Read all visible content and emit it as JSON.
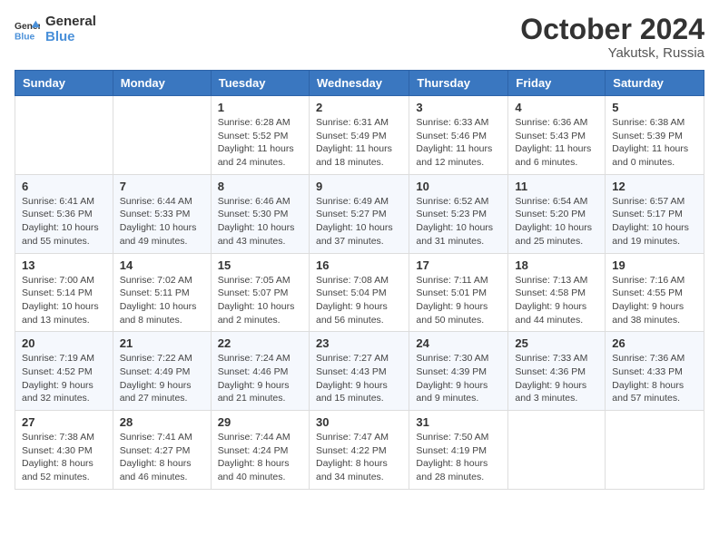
{
  "logo": {
    "line1": "General",
    "line2": "Blue"
  },
  "title": "October 2024",
  "subtitle": "Yakutsk, Russia",
  "days_header": [
    "Sunday",
    "Monday",
    "Tuesday",
    "Wednesday",
    "Thursday",
    "Friday",
    "Saturday"
  ],
  "weeks": [
    [
      {
        "day": "",
        "content": ""
      },
      {
        "day": "",
        "content": ""
      },
      {
        "day": "1",
        "content": "Sunrise: 6:28 AM\nSunset: 5:52 PM\nDaylight: 11 hours and 24 minutes."
      },
      {
        "day": "2",
        "content": "Sunrise: 6:31 AM\nSunset: 5:49 PM\nDaylight: 11 hours and 18 minutes."
      },
      {
        "day": "3",
        "content": "Sunrise: 6:33 AM\nSunset: 5:46 PM\nDaylight: 11 hours and 12 minutes."
      },
      {
        "day": "4",
        "content": "Sunrise: 6:36 AM\nSunset: 5:43 PM\nDaylight: 11 hours and 6 minutes."
      },
      {
        "day": "5",
        "content": "Sunrise: 6:38 AM\nSunset: 5:39 PM\nDaylight: 11 hours and 0 minutes."
      }
    ],
    [
      {
        "day": "6",
        "content": "Sunrise: 6:41 AM\nSunset: 5:36 PM\nDaylight: 10 hours and 55 minutes."
      },
      {
        "day": "7",
        "content": "Sunrise: 6:44 AM\nSunset: 5:33 PM\nDaylight: 10 hours and 49 minutes."
      },
      {
        "day": "8",
        "content": "Sunrise: 6:46 AM\nSunset: 5:30 PM\nDaylight: 10 hours and 43 minutes."
      },
      {
        "day": "9",
        "content": "Sunrise: 6:49 AM\nSunset: 5:27 PM\nDaylight: 10 hours and 37 minutes."
      },
      {
        "day": "10",
        "content": "Sunrise: 6:52 AM\nSunset: 5:23 PM\nDaylight: 10 hours and 31 minutes."
      },
      {
        "day": "11",
        "content": "Sunrise: 6:54 AM\nSunset: 5:20 PM\nDaylight: 10 hours and 25 minutes."
      },
      {
        "day": "12",
        "content": "Sunrise: 6:57 AM\nSunset: 5:17 PM\nDaylight: 10 hours and 19 minutes."
      }
    ],
    [
      {
        "day": "13",
        "content": "Sunrise: 7:00 AM\nSunset: 5:14 PM\nDaylight: 10 hours and 13 minutes."
      },
      {
        "day": "14",
        "content": "Sunrise: 7:02 AM\nSunset: 5:11 PM\nDaylight: 10 hours and 8 minutes."
      },
      {
        "day": "15",
        "content": "Sunrise: 7:05 AM\nSunset: 5:07 PM\nDaylight: 10 hours and 2 minutes."
      },
      {
        "day": "16",
        "content": "Sunrise: 7:08 AM\nSunset: 5:04 PM\nDaylight: 9 hours and 56 minutes."
      },
      {
        "day": "17",
        "content": "Sunrise: 7:11 AM\nSunset: 5:01 PM\nDaylight: 9 hours and 50 minutes."
      },
      {
        "day": "18",
        "content": "Sunrise: 7:13 AM\nSunset: 4:58 PM\nDaylight: 9 hours and 44 minutes."
      },
      {
        "day": "19",
        "content": "Sunrise: 7:16 AM\nSunset: 4:55 PM\nDaylight: 9 hours and 38 minutes."
      }
    ],
    [
      {
        "day": "20",
        "content": "Sunrise: 7:19 AM\nSunset: 4:52 PM\nDaylight: 9 hours and 32 minutes."
      },
      {
        "day": "21",
        "content": "Sunrise: 7:22 AM\nSunset: 4:49 PM\nDaylight: 9 hours and 27 minutes."
      },
      {
        "day": "22",
        "content": "Sunrise: 7:24 AM\nSunset: 4:46 PM\nDaylight: 9 hours and 21 minutes."
      },
      {
        "day": "23",
        "content": "Sunrise: 7:27 AM\nSunset: 4:43 PM\nDaylight: 9 hours and 15 minutes."
      },
      {
        "day": "24",
        "content": "Sunrise: 7:30 AM\nSunset: 4:39 PM\nDaylight: 9 hours and 9 minutes."
      },
      {
        "day": "25",
        "content": "Sunrise: 7:33 AM\nSunset: 4:36 PM\nDaylight: 9 hours and 3 minutes."
      },
      {
        "day": "26",
        "content": "Sunrise: 7:36 AM\nSunset: 4:33 PM\nDaylight: 8 hours and 57 minutes."
      }
    ],
    [
      {
        "day": "27",
        "content": "Sunrise: 7:38 AM\nSunset: 4:30 PM\nDaylight: 8 hours and 52 minutes."
      },
      {
        "day": "28",
        "content": "Sunrise: 7:41 AM\nSunset: 4:27 PM\nDaylight: 8 hours and 46 minutes."
      },
      {
        "day": "29",
        "content": "Sunrise: 7:44 AM\nSunset: 4:24 PM\nDaylight: 8 hours and 40 minutes."
      },
      {
        "day": "30",
        "content": "Sunrise: 7:47 AM\nSunset: 4:22 PM\nDaylight: 8 hours and 34 minutes."
      },
      {
        "day": "31",
        "content": "Sunrise: 7:50 AM\nSunset: 4:19 PM\nDaylight: 8 hours and 28 minutes."
      },
      {
        "day": "",
        "content": ""
      },
      {
        "day": "",
        "content": ""
      }
    ]
  ]
}
